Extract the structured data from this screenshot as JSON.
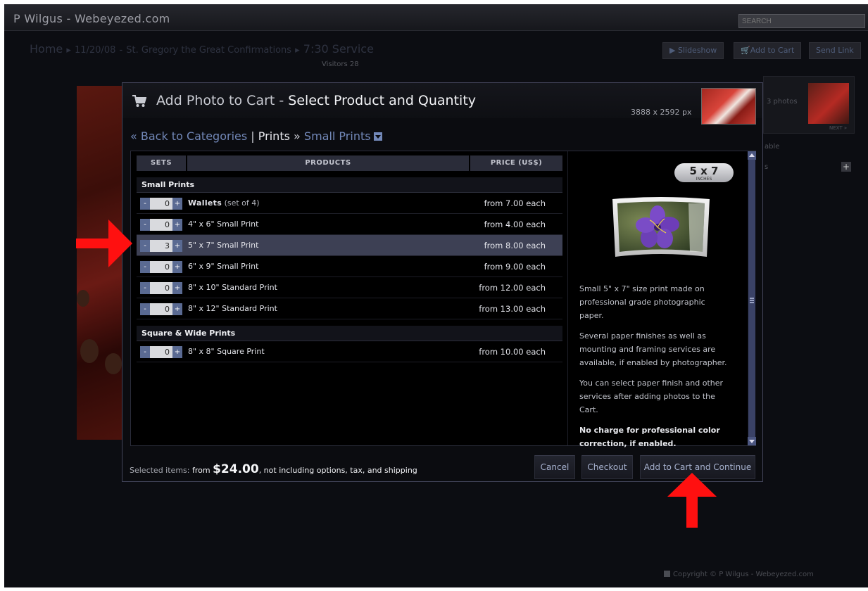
{
  "site": {
    "title": "P Wilgus - Webeyezed.com",
    "search_placeholder": "SEARCH"
  },
  "breadcrumb": {
    "home": "Home",
    "sep": "▸",
    "date": "11/20/08",
    "gallery": "St. Gregory the Great Confirmations",
    "current": "7:30 Service"
  },
  "visitors": "Visitors 28",
  "toolbar": {
    "slideshow": "Slideshow",
    "add_to_cart": "Add to Cart",
    "send_link": "Send Link"
  },
  "background": {
    "photos_text": "3 photos",
    "next": "NEXT »",
    "able_text": "able",
    "s_text": "s",
    "plus": "+"
  },
  "copyright": "Copyright © P Wilgus - Webeyezed.com",
  "modal": {
    "title_prefix": "Add Photo to Cart",
    "title_dash": " - ",
    "title_main": "Select Product and Quantity",
    "dimensions": "3888 x 2592 px",
    "nav": {
      "back": "« Back to Categories",
      "bar": "|",
      "category": "Prints",
      "arrow": "»",
      "subcategory": "Small Prints"
    },
    "columns": {
      "sets": "SETS",
      "products": "PRODUCTS",
      "price": "PRICE (US$)"
    },
    "groups": [
      {
        "name": "Small Prints",
        "items": [
          {
            "qty": "0",
            "name": "Wallets",
            "note": " (set of 4)",
            "price": "from 7.00 each"
          },
          {
            "qty": "0",
            "name": "4\" x 6\" Small Print",
            "price": "from 4.00 each"
          },
          {
            "qty": "3",
            "name": "5\" x 7\" Small Print",
            "price": "from 8.00 each",
            "selected": true
          },
          {
            "qty": "0",
            "name": "6\" x 9\" Small Print",
            "price": "from 9.00 each"
          },
          {
            "qty": "0",
            "name": "8\" x 10\" Standard Print",
            "price": "from 12.00 each"
          },
          {
            "qty": "0",
            "name": "8\" x 12\" Standard Print",
            "price": "from 13.00 each"
          }
        ]
      },
      {
        "name": "Square & Wide Prints",
        "items": [
          {
            "qty": "0",
            "name": "8\" x 8\" Square Print",
            "price": "from 10.00 each"
          }
        ]
      }
    ],
    "stepper": {
      "minus": "-",
      "plus": "+"
    },
    "detail": {
      "badge_size": "5 x 7",
      "badge_unit": "INCHES",
      "desc1": "Small 5\" x 7\" size print made on professional grade photographic paper.",
      "desc2": "Several paper finishes as well as mounting and framing services are available, if enabled by photographer.",
      "desc3": "You can select paper finish and other services after adding photos to the Cart.",
      "desc4": "No charge for professional color correction, if enabled."
    },
    "footer": {
      "selected_label": "Selected items: ",
      "from": "from ",
      "total": "$24.00",
      "suffix": ", not including options, tax, and shipping",
      "cancel": "Cancel",
      "checkout": "Checkout",
      "add_continue": "Add to Cart and Continue"
    }
  },
  "colors": {
    "accent": "#7288b8",
    "selected_row": "#3d4054",
    "annotation": "#ff0000"
  }
}
